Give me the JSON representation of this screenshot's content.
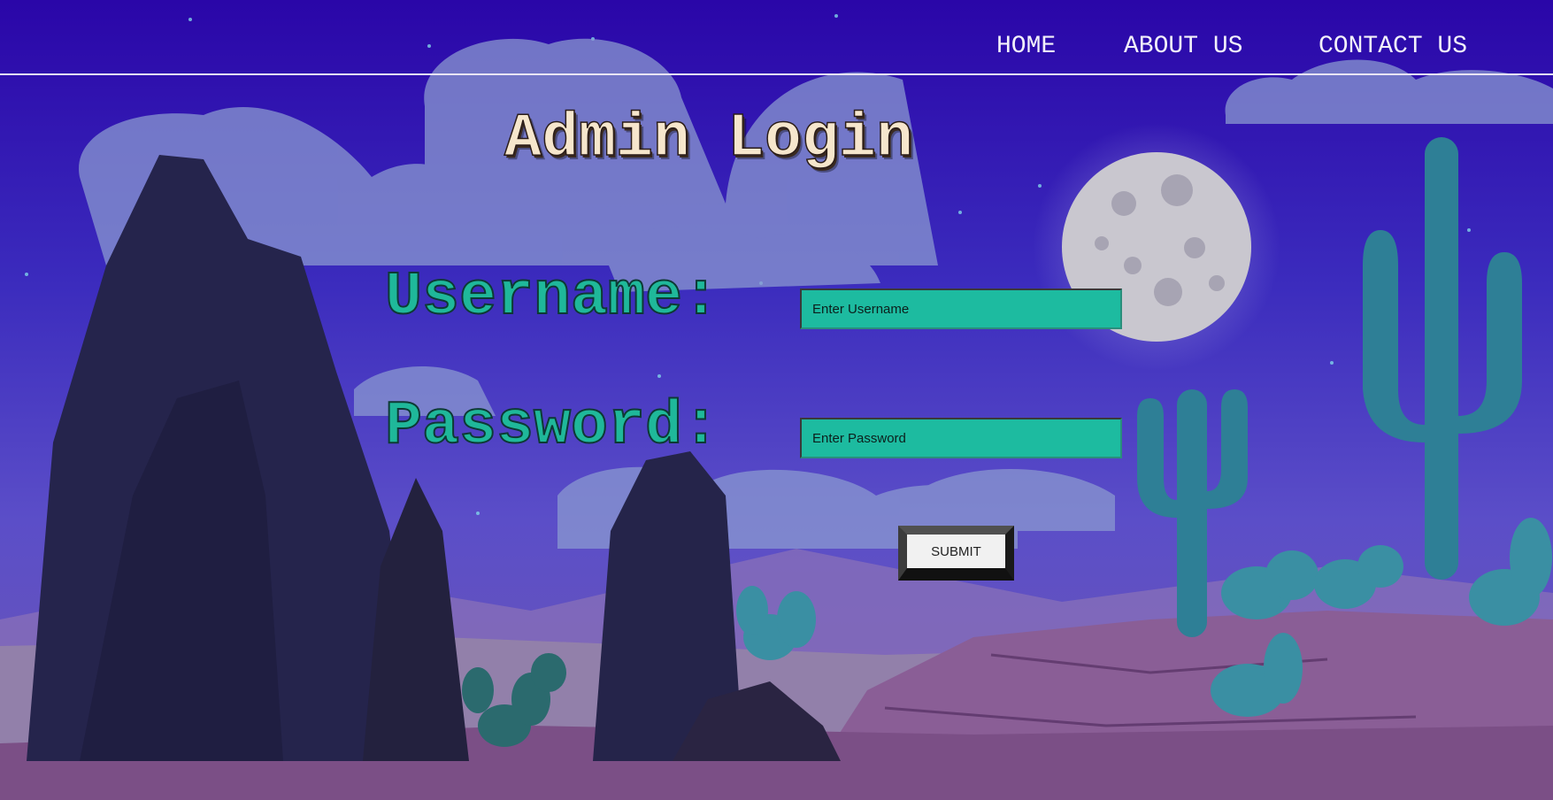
{
  "nav": {
    "home": "HOME",
    "about": "ABOUT US",
    "contact": "CONTACT US"
  },
  "login": {
    "title": "Admin Login",
    "username_label": "Username:",
    "username_placeholder": "Enter Username",
    "password_label": "Password:",
    "password_placeholder": "Enter Password",
    "submit_label": "SUBMIT"
  },
  "colors": {
    "sky": "#2a0aa6",
    "input_fill": "#1dbba0",
    "label_green": "#1fb89a",
    "title_cream": "#f6e6cc"
  },
  "icons": {
    "background": "desert-night-illustration",
    "moon": "full-moon",
    "cactus": "saguaro-cactus"
  }
}
